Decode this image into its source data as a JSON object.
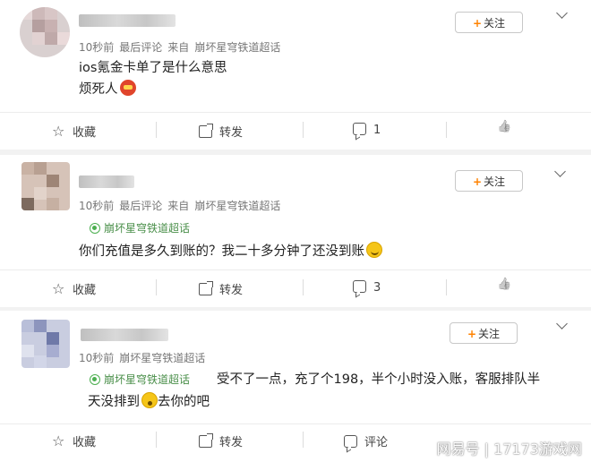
{
  "posts": [
    {
      "timestamp": "10秒前",
      "last_comment": "最后评论",
      "source_prefix": "来自",
      "source": "崩坏星穹铁道超话",
      "topic": "",
      "content_lines": [
        "ios氪金卡单了是什么意思",
        "烦死人"
      ],
      "follow_label": "关注",
      "actions": {
        "favorite": "收藏",
        "repost": "转发",
        "comment": "1",
        "like": ""
      }
    },
    {
      "timestamp": "10秒前",
      "last_comment": "最后评论",
      "source_prefix": "来自",
      "source": "崩坏星穹铁道超话",
      "topic": "崩坏星穹铁道超话",
      "content_lines": [
        "你们充值是多久到账的？我二十多分钟了还没到账"
      ],
      "follow_label": "关注",
      "actions": {
        "favorite": "收藏",
        "repost": "转发",
        "comment": "3",
        "like": ""
      }
    },
    {
      "timestamp": "10秒前",
      "last_comment": "",
      "source_prefix": "",
      "source": "崩坏星穹铁道超话",
      "topic": "崩坏星穹铁道超话",
      "content_lines": [
        "受不了一点，充了个198，半个小时没入账，客服排队半",
        "天没排到",
        "去你的吧"
      ],
      "follow_label": "关注",
      "actions": {
        "favorite": "收藏",
        "repost": "转发",
        "comment": "评论",
        "like": ""
      }
    }
  ],
  "watermark": "网易号 | 17173游戏网",
  "icons": [
    "star-icon",
    "repost-icon",
    "comment-icon",
    "like-icon",
    "chevron-down-icon",
    "plus-icon",
    "topic-icon"
  ],
  "colors": {
    "accent": "#ff8200",
    "topic_green": "#4a8f4a",
    "background": "#f2f2f2"
  }
}
